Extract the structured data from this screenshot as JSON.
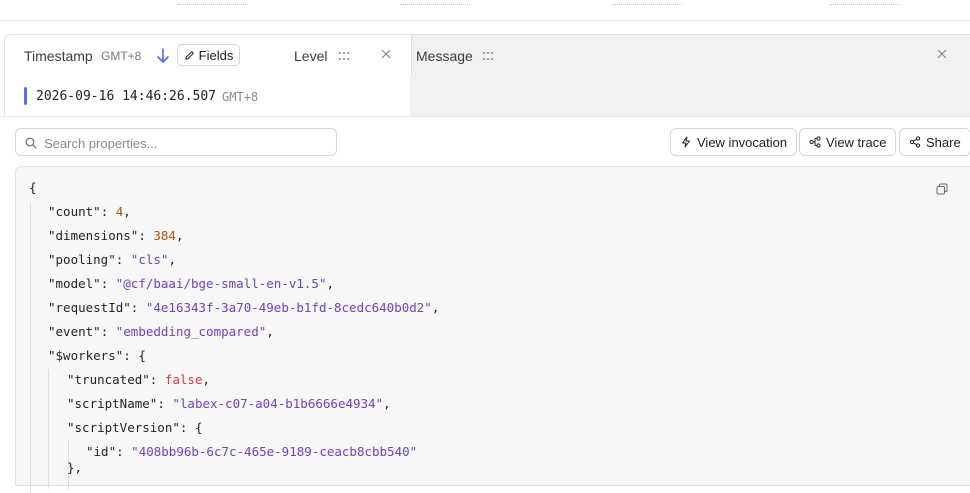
{
  "header": {
    "timestamp_label": "Timestamp",
    "timezone_label": "GMT+8",
    "fields_label": "Fields",
    "level_label": "Level",
    "message_label": "Message"
  },
  "row": {
    "timestamp": "2026-09-16 14:46:26.507",
    "timezone": "GMT+8",
    "level_color": "#5b6cf0"
  },
  "search": {
    "placeholder": "Search properties..."
  },
  "actions": {
    "view_invocation": "View invocation",
    "view_trace": "View trace",
    "share": "Share"
  },
  "json": {
    "open_brace": "{",
    "count_key": "\"count\"",
    "count_val": "4",
    "dimensions_key": "\"dimensions\"",
    "dimensions_val": "384",
    "pooling_key": "\"pooling\"",
    "pooling_val": "\"cls\"",
    "model_key": "\"model\"",
    "model_val": "\"@cf/baai/bge-small-en-v1.5\"",
    "requestId_key": "\"requestId\"",
    "requestId_val": "\"4e16343f-3a70-49eb-b1fd-8cedc640b0d2\"",
    "event_key": "\"event\"",
    "event_val": "\"embedding_compared\"",
    "workers_key": "\"$workers\"",
    "truncated_key": "\"truncated\"",
    "truncated_val": "false",
    "scriptName_key": "\"scriptName\"",
    "scriptName_val": "\"labex-c07-a04-b1b6666e4934\"",
    "scriptVersion_key": "\"scriptVersion\"",
    "id_key": "\"id\"",
    "id_val": "\"408bb96b-6c7c-465e-9189-ceacb8cbb540\"",
    "close_inner": "},"
  }
}
